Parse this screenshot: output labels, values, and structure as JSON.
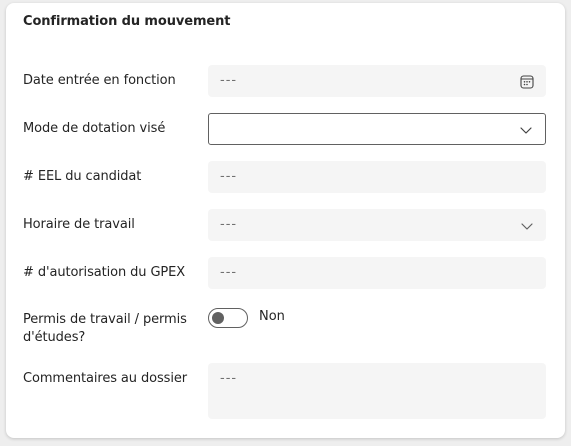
{
  "section": {
    "title": "Confirmation du mouvement"
  },
  "fields": {
    "date_entree": {
      "label": "Date entrée en fonction",
      "value": "---",
      "icon": "calendar-icon"
    },
    "mode_dotation": {
      "label": "Mode de dotation visé",
      "value": "",
      "icon": "chevron-down-icon"
    },
    "eel": {
      "label": "# EEL du candidat",
      "value": "---"
    },
    "horaire": {
      "label": "Horaire de travail",
      "value": "---",
      "icon": "chevron-down-icon"
    },
    "gpex": {
      "label": "# d'autorisation du GPEX",
      "value": "---"
    },
    "permis": {
      "label": "Permis de travail / permis d'études?",
      "toggle_state": "Non",
      "checked": false
    },
    "commentaires": {
      "label": "Commentaires au dossier",
      "value": "---"
    }
  },
  "colors": {
    "field_background": "#f5f5f5",
    "text": "#242424",
    "placeholder": "#707070",
    "border": "#616161"
  }
}
